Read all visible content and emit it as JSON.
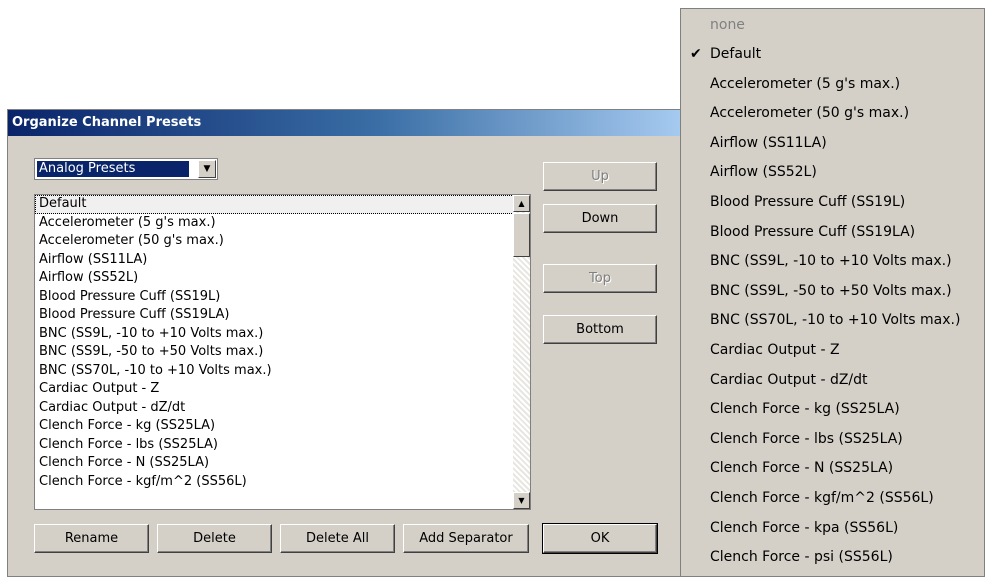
{
  "dialog": {
    "title": "Organize Channel Presets",
    "preset_type": "Analog Presets",
    "presets": [
      "Default",
      "Accelerometer (5 g's max.)",
      "Accelerometer (50 g's max.)",
      "Airflow (SS11LA)",
      "Airflow (SS52L)",
      "Blood Pressure Cuff (SS19L)",
      "Blood Pressure Cuff (SS19LA)",
      "BNC (SS9L, -10 to +10 Volts max.)",
      "BNC (SS9L, -50 to +50 Volts max.)",
      "BNC (SS70L, -10 to +10 Volts max.)",
      "Cardiac Output - Z",
      "Cardiac Output - dZ/dt",
      "Clench Force - kg (SS25LA)",
      "Clench Force - lbs (SS25LA)",
      "Clench Force - N (SS25LA)",
      "Clench Force - kgf/m^2 (SS56L)"
    ],
    "buttons": {
      "up": "Up",
      "down": "Down",
      "top": "Top",
      "bottom": "Bottom",
      "rename": "Rename",
      "delete": "Delete",
      "delete_all": "Delete All",
      "add_separator": "Add Separator",
      "ok": "OK"
    }
  },
  "menu": {
    "none_label": "none",
    "checkmark": "✔",
    "items": [
      "Default",
      "Accelerometer (5 g's max.)",
      "Accelerometer (50 g's max.)",
      "Airflow (SS11LA)",
      "Airflow (SS52L)",
      "Blood Pressure Cuff (SS19L)",
      "Blood Pressure Cuff (SS19LA)",
      "BNC (SS9L, -10 to +10 Volts max.)",
      "BNC (SS9L, -50 to +50 Volts max.)",
      "BNC (SS70L, -10 to +10 Volts max.)",
      "Cardiac Output - Z",
      "Cardiac Output - dZ/dt",
      "Clench Force - kg (SS25LA)",
      "Clench Force - lbs (SS25LA)",
      "Clench Force - N (SS25LA)",
      "Clench Force - kgf/m^2 (SS56L)",
      "Clench Force - kpa (SS56L)",
      "Clench Force - psi (SS56L)"
    ]
  },
  "icons": {
    "combo_arrow": "▼",
    "scroll_up": "▲",
    "scroll_down": "▼"
  },
  "colors": {
    "title_start": "#0a246a",
    "title_end": "#a6caf0",
    "face": "#d4d0c8",
    "selection": "#0a246a"
  }
}
